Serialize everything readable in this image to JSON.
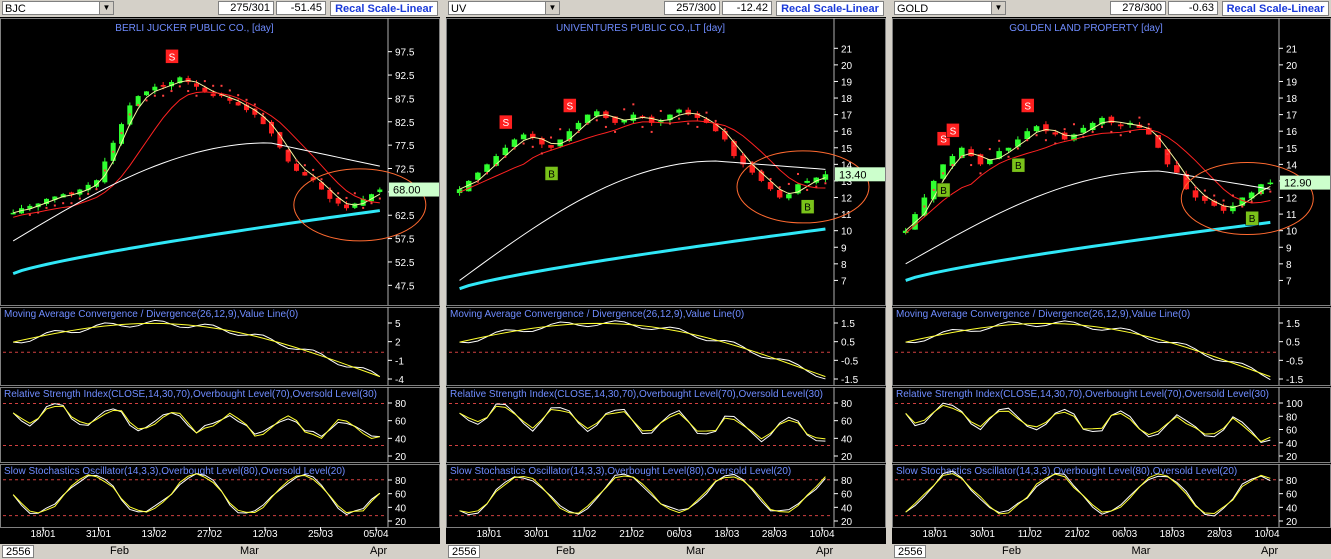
{
  "colors": {
    "up": "#30ff30",
    "down": "#ff2020",
    "sma_fast": "#f5f5a0",
    "sma_mid": "#ff2222",
    "sma_long": "#ffffff",
    "sma_200": "#30e8f8",
    "sar": "#ff4040",
    "ellipse": "#ff6a30",
    "title": "#6f8cff",
    "axis": "#ffffff",
    "signal_s": "#ff2020",
    "signal_b": "#7ac21a",
    "highlight": "#ccffcc",
    "osc_line": "#ffff30",
    "osc_signal": "#ffffff",
    "level_line": "#d04040",
    "button_text": "#1a3ad9"
  },
  "panels": [
    {
      "symbol": "BJC",
      "counter": "275/301",
      "change": "-51.45",
      "recal_label": "Recal Scale-Linear",
      "year_label": "2556",
      "date_ticks": [
        "18/01",
        "31/01",
        "13/02",
        "27/02",
        "12/03",
        "25/03",
        "05/04"
      ],
      "month_labels": [
        "Feb",
        "Mar",
        "Apr"
      ],
      "chart_data": {
        "type": "candlestick",
        "title": "BERLI JUCKER PUBLIC CO., [day]",
        "y_ticks": [
          "97.5",
          "92.5",
          "87.5",
          "82.5",
          "77.5",
          "72.5",
          "67.5",
          "62.5",
          "57.5",
          "52.5",
          "47.5"
        ],
        "ylim": [
          45,
          100
        ],
        "last_value": "68.00",
        "closes": [
          63,
          64,
          64.5,
          65,
          66,
          66.5,
          67,
          67,
          68,
          69,
          70,
          74,
          78,
          82,
          86,
          88,
          89,
          90,
          90,
          91,
          92,
          91,
          90,
          89,
          88,
          88,
          87,
          86,
          85,
          84,
          82,
          80,
          77,
          74,
          72,
          71,
          70,
          68,
          66,
          65,
          64,
          65,
          66,
          67,
          68
        ],
        "sma_long_start": 57,
        "sma_long_peak": 78,
        "sma_long_end": 73,
        "sma_200_start": 50,
        "sma_200_end": 63.5,
        "signals": [
          {
            "label": "S",
            "x_index": 19,
            "type": "sell"
          }
        ]
      },
      "macd": {
        "title": "Moving Average Convergence / Divergence(26,12,9),Value Line(0)",
        "ticks": [
          "5",
          "2",
          "-1",
          "-4"
        ]
      },
      "rsi": {
        "title": "Relative Strength Index(CLOSE,14,30,70),Overbought Level(70),Oversold Level(30)",
        "ticks": [
          "80",
          "60",
          "40",
          "20"
        ]
      },
      "stoch": {
        "title": "Slow Stochastics Oscillator(14,3,3),Overbought Level(80),Oversold Level(20)",
        "ticks": [
          "80",
          "60",
          "40",
          "20"
        ]
      }
    },
    {
      "symbol": "UV",
      "counter": "257/300",
      "change": "-12.42",
      "recal_label": "Recal Scale-Linear",
      "year_label": "2556",
      "date_ticks": [
        "18/01",
        "30/01",
        "11/02",
        "21/02",
        "06/03",
        "18/03",
        "28/03",
        "10/04"
      ],
      "month_labels": [
        "Feb",
        "Mar",
        "Apr"
      ],
      "chart_data": {
        "type": "candlestick",
        "title": "UNIVENTURES PUBLIC CO.,LT [day]",
        "y_ticks": [
          "21",
          "20",
          "19",
          "18",
          "17",
          "16",
          "15",
          "14",
          "13",
          "12",
          "11",
          "10",
          "9",
          "8",
          "7"
        ],
        "ylim": [
          6,
          21.5
        ],
        "last_value": "13.40",
        "closes": [
          12.5,
          13,
          13.5,
          14,
          14.5,
          15,
          15.5,
          15.8,
          15.6,
          15.2,
          15,
          15.5,
          16,
          16.5,
          17,
          17.2,
          16.8,
          16.5,
          16.7,
          17,
          16.8,
          16.5,
          16.6,
          17,
          17.3,
          17,
          16.8,
          16.5,
          16,
          15.5,
          14.5,
          14,
          13.5,
          13,
          12.5,
          12,
          12.2,
          12.8,
          13,
          13.2,
          13.4
        ],
        "sma_long_start": 7,
        "sma_long_peak": 14.2,
        "sma_long_end": 13.7,
        "sma_200_start": 6.5,
        "sma_200_end": 10.1,
        "signals": [
          {
            "label": "S",
            "x_index": 5,
            "type": "sell"
          },
          {
            "label": "S",
            "x_index": 12,
            "type": "sell"
          },
          {
            "label": "B",
            "x_index": 10,
            "type": "buy"
          },
          {
            "label": "B",
            "x_index": 38,
            "type": "buy"
          }
        ]
      },
      "macd": {
        "title": "Moving Average Convergence / Divergence(26,12,9),Value Line(0)",
        "ticks": [
          "1.5",
          "0.5",
          "-0.5",
          "-1.5"
        ]
      },
      "rsi": {
        "title": "Relative Strength Index(CLOSE,14,30,70),Overbought Level(70),Oversold Level(30)",
        "ticks": [
          "80",
          "60",
          "40",
          "20"
        ]
      },
      "stoch": {
        "title": "Slow Stochastics Oscillator(14,3,3),Overbought Level(80),Oversold Level(20)",
        "ticks": [
          "80",
          "60",
          "40",
          "20"
        ]
      }
    },
    {
      "symbol": "GOLD",
      "counter": "278/300",
      "change": "-0.63",
      "recal_label": "Recal Scale-Linear",
      "year_label": "2556",
      "date_ticks": [
        "18/01",
        "30/01",
        "11/02",
        "21/02",
        "06/03",
        "18/03",
        "28/03",
        "10/04"
      ],
      "month_labels": [
        "Feb",
        "Mar",
        "Apr"
      ],
      "chart_data": {
        "type": "candlestick",
        "title": "GOLDEN LAND PROPERTY [day]",
        "y_ticks": [
          "21",
          "20",
          "19",
          "18",
          "17",
          "16",
          "15",
          "14",
          "13",
          "12",
          "11",
          "10",
          "9",
          "8",
          "7"
        ],
        "ylim": [
          6,
          21.5
        ],
        "last_value": "12.90",
        "closes": [
          10,
          11,
          12,
          13,
          14,
          14.5,
          15,
          14.5,
          14,
          14.3,
          14.8,
          15,
          15.5,
          16,
          16.3,
          16,
          15.8,
          15.5,
          15.8,
          16.2,
          16.5,
          16.8,
          16.5,
          16.3,
          16.5,
          16.2,
          15.8,
          15,
          14,
          13.5,
          12.5,
          12,
          11.8,
          11.5,
          11.2,
          11.5,
          12,
          12.3,
          12.8,
          12.9
        ],
        "sma_long_start": 8,
        "sma_long_peak": 13.6,
        "sma_long_end": 12.5,
        "sma_200_start": 7,
        "sma_200_end": 10.5,
        "signals": [
          {
            "label": "S",
            "x_index": 4,
            "type": "sell"
          },
          {
            "label": "S",
            "x_index": 5,
            "type": "sell"
          },
          {
            "label": "S",
            "x_index": 13,
            "type": "sell"
          },
          {
            "label": "B",
            "x_index": 4,
            "type": "buy"
          },
          {
            "label": "B",
            "x_index": 12,
            "type": "buy"
          },
          {
            "label": "B",
            "x_index": 37,
            "type": "buy"
          }
        ]
      },
      "macd": {
        "title": "Moving Average Convergence / Divergence(26,12,9),Value Line(0)",
        "ticks": [
          "1.5",
          "0.5",
          "-0.5",
          "-1.5"
        ]
      },
      "rsi": {
        "title": "Relative Strength Index(CLOSE,14,30,70),Overbought Level(70),Oversold Level(30)",
        "ticks": [
          "100",
          "80",
          "60",
          "40",
          "20"
        ]
      },
      "stoch": {
        "title": "Slow Stochastics Oscillator(14,3,3),Overbought Level(80),Oversold Level(20)",
        "ticks": [
          "80",
          "60",
          "40",
          "20"
        ]
      }
    }
  ]
}
